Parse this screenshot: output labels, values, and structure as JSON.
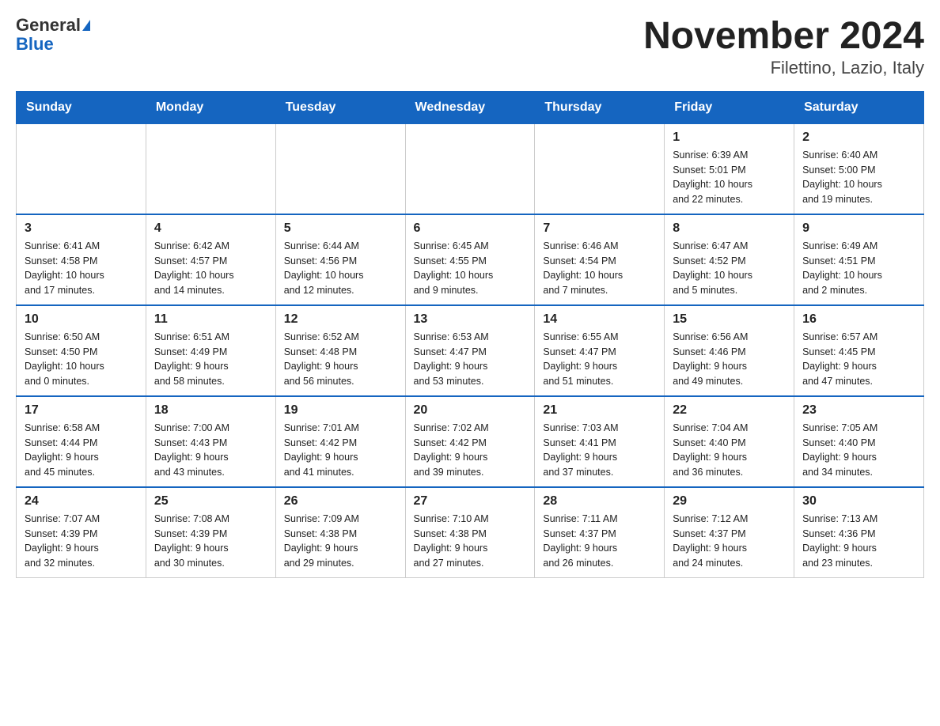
{
  "logo": {
    "general": "General",
    "blue": "Blue"
  },
  "title": "November 2024",
  "subtitle": "Filettino, Lazio, Italy",
  "weekdays": [
    "Sunday",
    "Monday",
    "Tuesday",
    "Wednesday",
    "Thursday",
    "Friday",
    "Saturday"
  ],
  "weeks": [
    [
      {
        "day": "",
        "info": ""
      },
      {
        "day": "",
        "info": ""
      },
      {
        "day": "",
        "info": ""
      },
      {
        "day": "",
        "info": ""
      },
      {
        "day": "",
        "info": ""
      },
      {
        "day": "1",
        "info": "Sunrise: 6:39 AM\nSunset: 5:01 PM\nDaylight: 10 hours\nand 22 minutes."
      },
      {
        "day": "2",
        "info": "Sunrise: 6:40 AM\nSunset: 5:00 PM\nDaylight: 10 hours\nand 19 minutes."
      }
    ],
    [
      {
        "day": "3",
        "info": "Sunrise: 6:41 AM\nSunset: 4:58 PM\nDaylight: 10 hours\nand 17 minutes."
      },
      {
        "day": "4",
        "info": "Sunrise: 6:42 AM\nSunset: 4:57 PM\nDaylight: 10 hours\nand 14 minutes."
      },
      {
        "day": "5",
        "info": "Sunrise: 6:44 AM\nSunset: 4:56 PM\nDaylight: 10 hours\nand 12 minutes."
      },
      {
        "day": "6",
        "info": "Sunrise: 6:45 AM\nSunset: 4:55 PM\nDaylight: 10 hours\nand 9 minutes."
      },
      {
        "day": "7",
        "info": "Sunrise: 6:46 AM\nSunset: 4:54 PM\nDaylight: 10 hours\nand 7 minutes."
      },
      {
        "day": "8",
        "info": "Sunrise: 6:47 AM\nSunset: 4:52 PM\nDaylight: 10 hours\nand 5 minutes."
      },
      {
        "day": "9",
        "info": "Sunrise: 6:49 AM\nSunset: 4:51 PM\nDaylight: 10 hours\nand 2 minutes."
      }
    ],
    [
      {
        "day": "10",
        "info": "Sunrise: 6:50 AM\nSunset: 4:50 PM\nDaylight: 10 hours\nand 0 minutes."
      },
      {
        "day": "11",
        "info": "Sunrise: 6:51 AM\nSunset: 4:49 PM\nDaylight: 9 hours\nand 58 minutes."
      },
      {
        "day": "12",
        "info": "Sunrise: 6:52 AM\nSunset: 4:48 PM\nDaylight: 9 hours\nand 56 minutes."
      },
      {
        "day": "13",
        "info": "Sunrise: 6:53 AM\nSunset: 4:47 PM\nDaylight: 9 hours\nand 53 minutes."
      },
      {
        "day": "14",
        "info": "Sunrise: 6:55 AM\nSunset: 4:47 PM\nDaylight: 9 hours\nand 51 minutes."
      },
      {
        "day": "15",
        "info": "Sunrise: 6:56 AM\nSunset: 4:46 PM\nDaylight: 9 hours\nand 49 minutes."
      },
      {
        "day": "16",
        "info": "Sunrise: 6:57 AM\nSunset: 4:45 PM\nDaylight: 9 hours\nand 47 minutes."
      }
    ],
    [
      {
        "day": "17",
        "info": "Sunrise: 6:58 AM\nSunset: 4:44 PM\nDaylight: 9 hours\nand 45 minutes."
      },
      {
        "day": "18",
        "info": "Sunrise: 7:00 AM\nSunset: 4:43 PM\nDaylight: 9 hours\nand 43 minutes."
      },
      {
        "day": "19",
        "info": "Sunrise: 7:01 AM\nSunset: 4:42 PM\nDaylight: 9 hours\nand 41 minutes."
      },
      {
        "day": "20",
        "info": "Sunrise: 7:02 AM\nSunset: 4:42 PM\nDaylight: 9 hours\nand 39 minutes."
      },
      {
        "day": "21",
        "info": "Sunrise: 7:03 AM\nSunset: 4:41 PM\nDaylight: 9 hours\nand 37 minutes."
      },
      {
        "day": "22",
        "info": "Sunrise: 7:04 AM\nSunset: 4:40 PM\nDaylight: 9 hours\nand 36 minutes."
      },
      {
        "day": "23",
        "info": "Sunrise: 7:05 AM\nSunset: 4:40 PM\nDaylight: 9 hours\nand 34 minutes."
      }
    ],
    [
      {
        "day": "24",
        "info": "Sunrise: 7:07 AM\nSunset: 4:39 PM\nDaylight: 9 hours\nand 32 minutes."
      },
      {
        "day": "25",
        "info": "Sunrise: 7:08 AM\nSunset: 4:39 PM\nDaylight: 9 hours\nand 30 minutes."
      },
      {
        "day": "26",
        "info": "Sunrise: 7:09 AM\nSunset: 4:38 PM\nDaylight: 9 hours\nand 29 minutes."
      },
      {
        "day": "27",
        "info": "Sunrise: 7:10 AM\nSunset: 4:38 PM\nDaylight: 9 hours\nand 27 minutes."
      },
      {
        "day": "28",
        "info": "Sunrise: 7:11 AM\nSunset: 4:37 PM\nDaylight: 9 hours\nand 26 minutes."
      },
      {
        "day": "29",
        "info": "Sunrise: 7:12 AM\nSunset: 4:37 PM\nDaylight: 9 hours\nand 24 minutes."
      },
      {
        "day": "30",
        "info": "Sunrise: 7:13 AM\nSunset: 4:36 PM\nDaylight: 9 hours\nand 23 minutes."
      }
    ]
  ]
}
